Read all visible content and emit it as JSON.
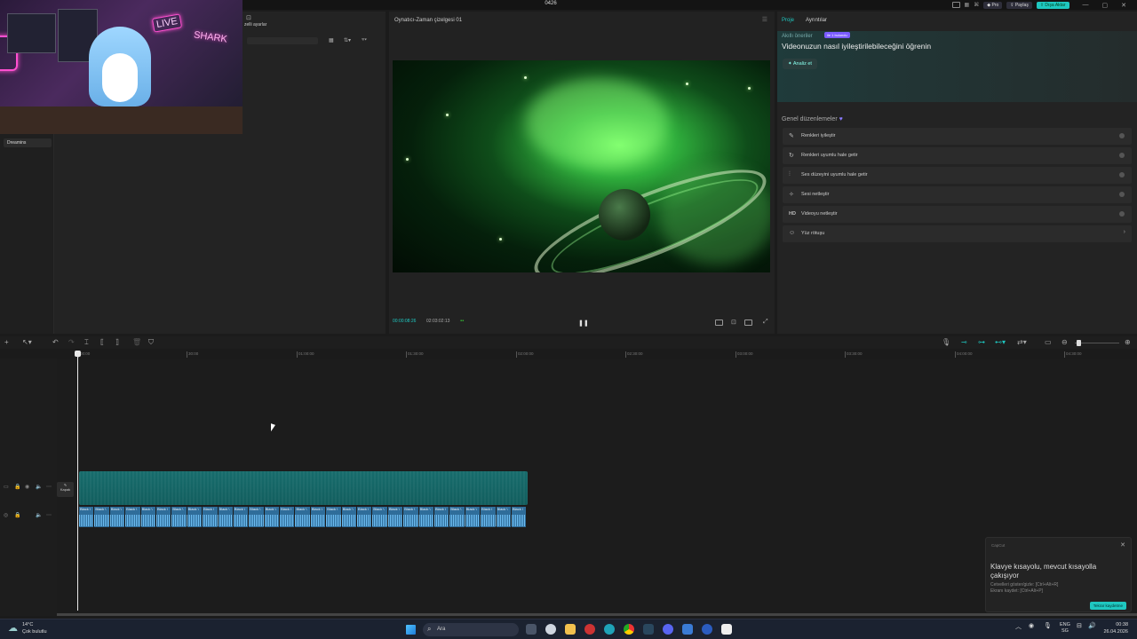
{
  "window": {
    "title": "0426",
    "pro_label": "Pro",
    "share_label": "Paylaş",
    "export_label": "Dışa Aktar"
  },
  "media": {
    "top_label": "zelli ayarlar",
    "sidebar_tag": "Dreamins",
    "cam_live_text": "LIVE",
    "cam_shark_text": "SHARK"
  },
  "player": {
    "title": "Oynatıcı-Zaman çizelgesi 01",
    "current_time": "00:00:08:26",
    "total_time": "02:03:02:13"
  },
  "props": {
    "tabs": [
      "Proje",
      "Ayrıntılar"
    ],
    "smart_header": "Akıllı öneriler",
    "smart_badge": "ile 1 bulundu",
    "smart_title": "Videonuzun nasıl iyileştirilebileceğini öğrenin",
    "analyze_label": "Analiz et",
    "general_header": "Genel düzenlemeler",
    "rows": [
      {
        "icon": "✎",
        "label": "Renkleri iyileştir"
      },
      {
        "icon": "↻",
        "label": "Renkleri uyumlu hale getir"
      },
      {
        "icon": "⫶",
        "label": "Ses düzeyini uyumlu hale getir"
      },
      {
        "icon": "✧",
        "label": "Sesi netleştir"
      },
      {
        "icon": "HD",
        "label": "Videoyu netleştir"
      },
      {
        "icon": "☺",
        "label": "Yüz rötuşu"
      }
    ]
  },
  "timeline": {
    "ruler": [
      "00:00",
      "|30:00",
      "|01:00:00",
      "|01:30:00",
      "|02:00:00",
      "|02:30:00",
      "|03:00:00",
      "|03:30:00",
      "|04:00:00",
      "|04:30:00"
    ],
    "cover_label": "Kapak",
    "audio_clip_name": "Black \\",
    "audio_clip_count": 29
  },
  "toast": {
    "source": "CapCut",
    "message": "Klavye kısayolu, mevcut kısayolla çakışıyor",
    "line1": "Cetvelleri göster/gizle: [Ctrl+Alt+R]",
    "line2": "Ekranı kaydet: [Ctrl+Alt+P]",
    "button": "Tekrar kaydetme"
  },
  "taskbar": {
    "temp": "14°C",
    "weather": "Çok bulutlu",
    "search_placeholder": "Ara",
    "lang1": "ENG",
    "lang2": "SG",
    "time": "00:38",
    "date": "26.04.2026"
  }
}
